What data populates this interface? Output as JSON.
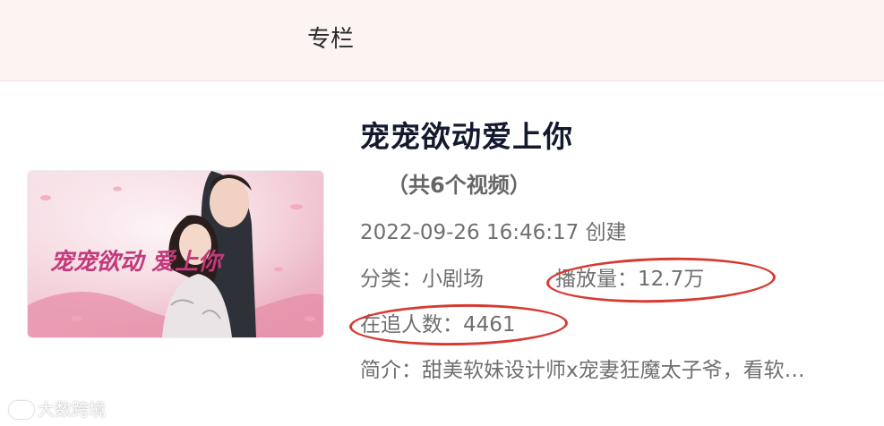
{
  "header": {
    "tab_label": "专栏",
    "background": "#fcf4f2"
  },
  "album": {
    "title": "宠宠欲动爱上你",
    "video_count": "（共6个视频）",
    "created": "2022-09-26 16:46:17 创建",
    "category": "分类：小剧场",
    "plays": "播放量：12.7万",
    "followers": "在追人数：4461",
    "intro": "简介：甜美软妹设计师x宠妻狂魔太子爷，看软…",
    "cover_text": "宠宠欲动 爱上你"
  },
  "annotations": {
    "circle_color": "#d63b33"
  },
  "watermark": {
    "text": "大数跨境"
  }
}
